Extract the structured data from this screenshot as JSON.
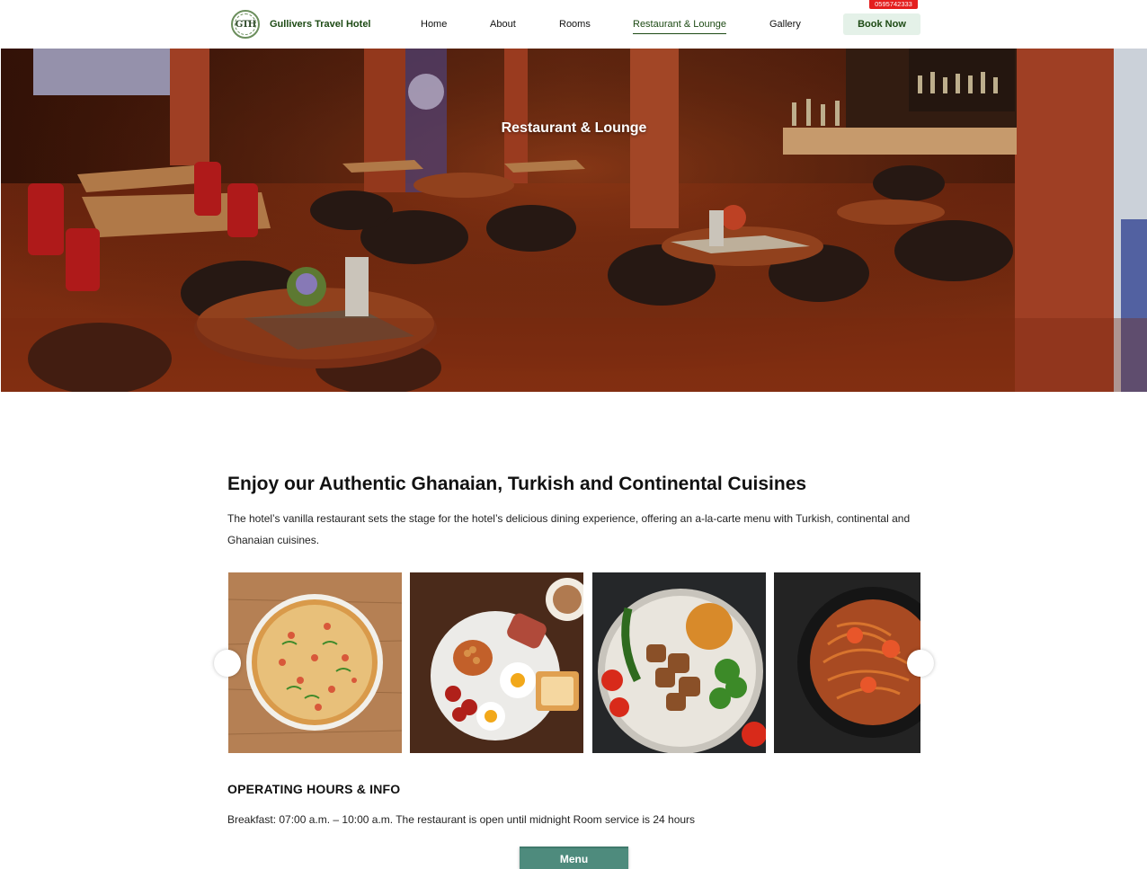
{
  "brand": {
    "name": "Gullivers Travel Hotel",
    "logo_text": "GTH"
  },
  "nav": {
    "items": [
      {
        "label": "Home"
      },
      {
        "label": "About"
      },
      {
        "label": "Rooms"
      },
      {
        "label": "Restaurant & Lounge",
        "active": true
      },
      {
        "label": "Gallery"
      }
    ],
    "book_label": "Book Now",
    "phone": "0595742333"
  },
  "hero": {
    "title": "Restaurant & Lounge"
  },
  "content": {
    "heading": "Enjoy our Authentic Ghanaian, Turkish and Continental Cuisines",
    "description": "The hotel’s vanilla restaurant sets the stage for the hotel’s delicious dining experience, offering an a-la-carte menu with Turkish, continental and Ghanaian cuisines."
  },
  "carousel": {
    "slides": [
      {
        "icon": "pizza-image"
      },
      {
        "icon": "breakfast-image"
      },
      {
        "icon": "kebab-image"
      },
      {
        "icon": "seafood-pasta-image"
      }
    ]
  },
  "hours": {
    "title": "OPERATING HOURS & INFO",
    "text": "Breakfast: 07:00 a.m. – 10:00 a.m. The restaurant is open until midnight Room service is 24 hours"
  },
  "menu_button": {
    "label": "Menu"
  },
  "colors": {
    "brand_green": "#1d4a14",
    "book_bg": "#e4f1e8",
    "phone_red": "#e41e1e",
    "menu_teal": "#4e8b7d"
  }
}
